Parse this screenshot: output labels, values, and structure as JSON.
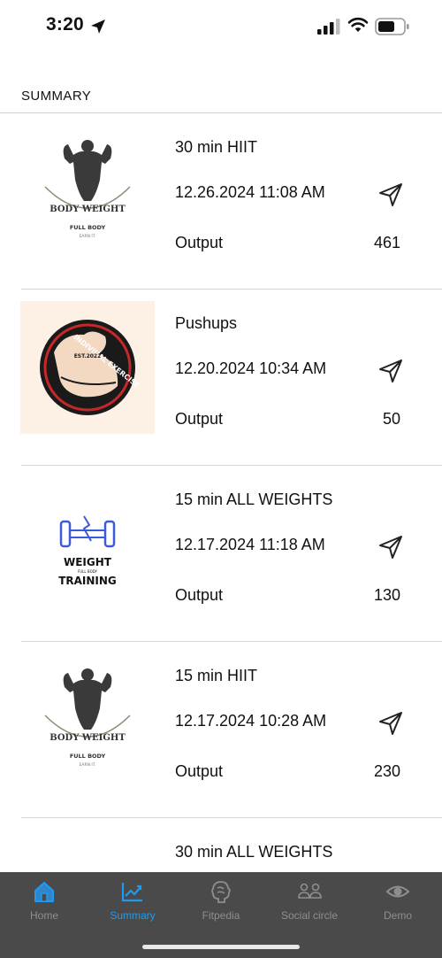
{
  "status_bar": {
    "time": "3:20"
  },
  "section": {
    "title": "SUMMARY"
  },
  "workouts": [
    {
      "title": "30 min HIIT",
      "date": "12.26.2024 11:08 AM",
      "output_label": "Output",
      "output_value": "461",
      "logo": {
        "type": "body-weight",
        "text_main": "BODY WEIGHT",
        "text_sub": "FULL BODY",
        "text_tag": "EARN IT."
      }
    },
    {
      "title": "Pushups",
      "date": "12.20.2024 10:34 AM",
      "output_label": "Output",
      "output_value": "50",
      "logo": {
        "type": "individual-exercise",
        "text_main": "INDIVIUAL EXERCISE",
        "text_sub": "EST.2022"
      }
    },
    {
      "title": "15 min ALL WEIGHTS",
      "date": "12.17.2024 11:18 AM",
      "output_label": "Output",
      "output_value": "130",
      "logo": {
        "type": "weight-training",
        "text_main": "WEIGHT",
        "text_sub": "FULL BODY",
        "text_tag": "TRAINING"
      }
    },
    {
      "title": "15 min HIIT",
      "date": "12.17.2024 10:28 AM",
      "output_label": "Output",
      "output_value": "230",
      "logo": {
        "type": "body-weight",
        "text_main": "BODY WEIGHT",
        "text_sub": "FULL BODY",
        "text_tag": "EARN IT."
      }
    },
    {
      "title": "30 min ALL WEIGHTS",
      "date": "",
      "output_label": "",
      "output_value": "",
      "logo": {
        "type": "weight-training",
        "text_main": "",
        "text_sub": "",
        "text_tag": ""
      }
    }
  ],
  "tabs": [
    {
      "label": "Home",
      "icon": "home-icon",
      "active": false
    },
    {
      "label": "Summary",
      "icon": "chart-icon",
      "active": true
    },
    {
      "label": "Fitpedia",
      "icon": "brain-icon",
      "active": false
    },
    {
      "label": "Social circle",
      "icon": "people-icon",
      "active": false
    },
    {
      "label": "Demo",
      "icon": "eye-icon",
      "active": false
    }
  ],
  "colors": {
    "accent": "#1e9af0",
    "tab_bar": "#4a4a4a",
    "tab_inactive": "#8e8e8e"
  }
}
